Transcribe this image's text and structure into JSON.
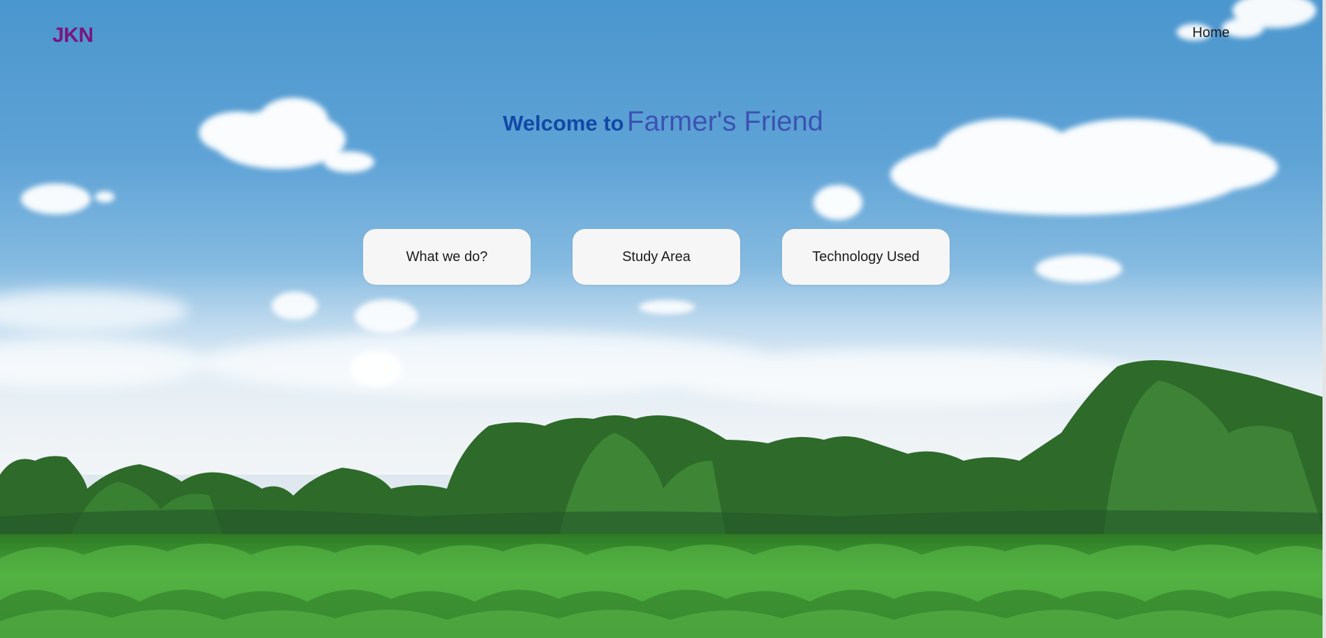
{
  "header": {
    "logo": "JKN",
    "nav": [
      {
        "label": "Home"
      }
    ]
  },
  "hero": {
    "welcome": "Welcome to",
    "brand": "Farmer's Friend"
  },
  "cards": [
    {
      "label": "What we do?"
    },
    {
      "label": "Study Area"
    },
    {
      "label": "Technology Used"
    }
  ],
  "colors": {
    "logo": "#7a157f",
    "welcome": "#1348a6",
    "brand": "#3b53b2",
    "card_bg": "#f6f6f6",
    "sky": "#4a96ce",
    "field": "#3e9a34"
  },
  "background": {
    "scene": "corn-field-with-trees-under-cloudy-blue-sky"
  }
}
